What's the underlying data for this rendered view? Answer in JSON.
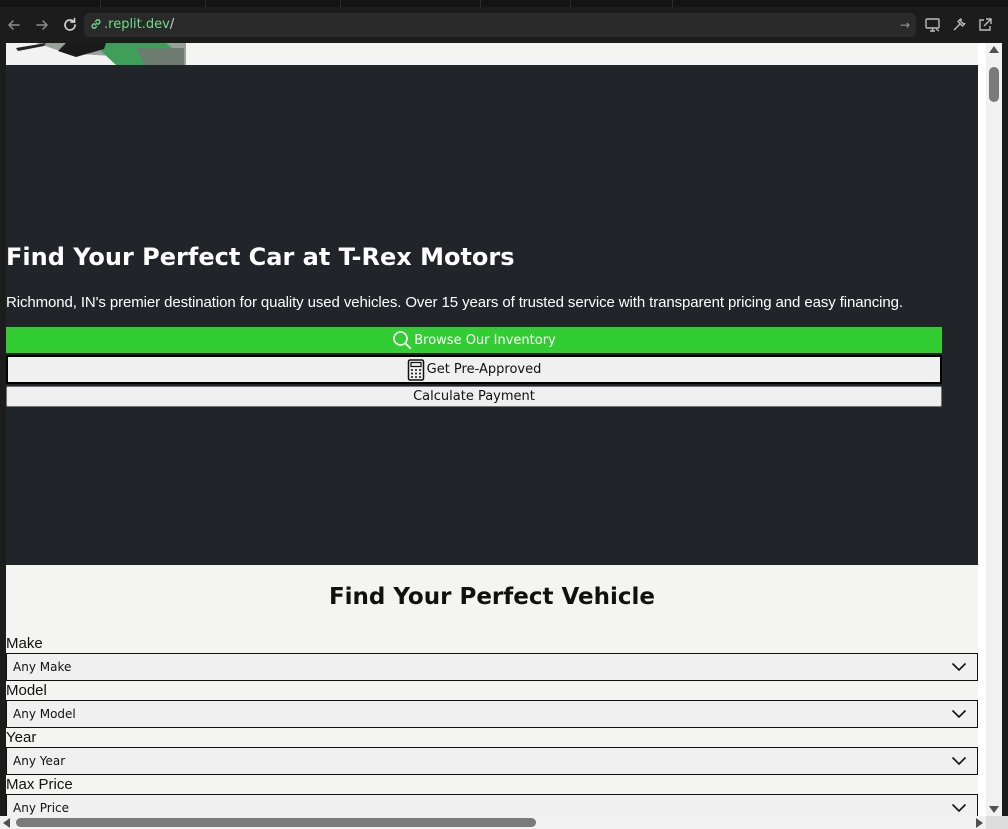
{
  "browser": {
    "url_domain": ".replit.dev",
    "url_path": "/",
    "url_go_icon": "arrow-right-icon",
    "back_icon": "arrow-left-icon",
    "forward_icon": "arrow-right-icon",
    "reload_icon": "reload-icon"
  },
  "hero": {
    "title": "Find Your Perfect Car at T-Rex Motors",
    "subtitle": "Richmond, IN's premier destination for quality used vehicles. Over 15 years of trusted service with transparent pricing and easy financing.",
    "buttons": {
      "browse": "Browse Our Inventory",
      "preapprove": "Get Pre-Approved",
      "calculate": "Calculate Payment"
    }
  },
  "search": {
    "title": "Find Your Perfect Vehicle",
    "fields": [
      {
        "label": "Make",
        "value": "Any Make"
      },
      {
        "label": "Model",
        "value": "Any Model"
      },
      {
        "label": "Year",
        "value": "Any Year"
      },
      {
        "label": "Max Price",
        "value": "Any Price"
      }
    ]
  },
  "colors": {
    "hero_bg": "#212529",
    "accent_green": "#32cd32",
    "page_bg": "#f4f4f2",
    "url_green": "#6fdc8c"
  }
}
